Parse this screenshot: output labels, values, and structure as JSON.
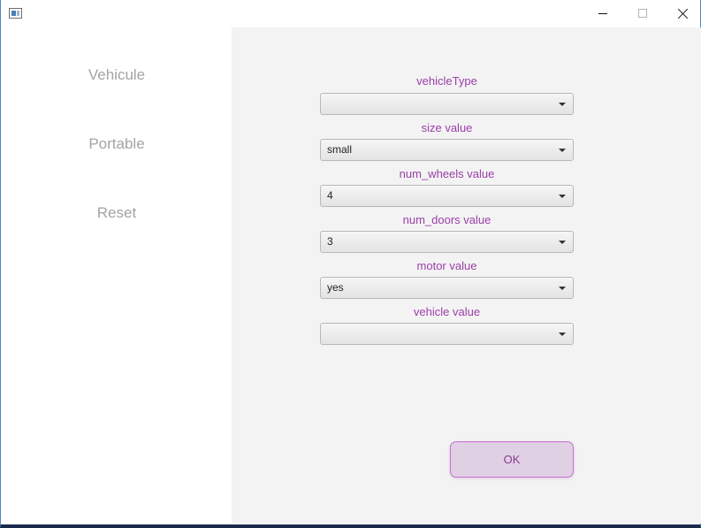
{
  "window": {
    "icon": "app-icon",
    "controls": [
      "minimize-icon",
      "maximize-icon",
      "close-icon"
    ]
  },
  "sidebar": {
    "items": [
      {
        "label": "Vehicule"
      },
      {
        "label": "Portable"
      },
      {
        "label": "Reset"
      }
    ]
  },
  "form": {
    "fields": [
      {
        "label": "vehicleType",
        "value": ""
      },
      {
        "label": "size value",
        "value": "small"
      },
      {
        "label": "num_wheels value",
        "value": "4"
      },
      {
        "label": "num_doors value",
        "value": "3"
      },
      {
        "label": "motor value",
        "value": "yes"
      },
      {
        "label": "vehicle value",
        "value": ""
      }
    ],
    "ok_label": "OK"
  },
  "colors": {
    "label_accent": "#9b3fa8",
    "button_fill": "#e0d0e3",
    "button_border": "#c76fd4",
    "panel_bg": "#f3f3f3",
    "nav_text": "#a3a3a3"
  }
}
